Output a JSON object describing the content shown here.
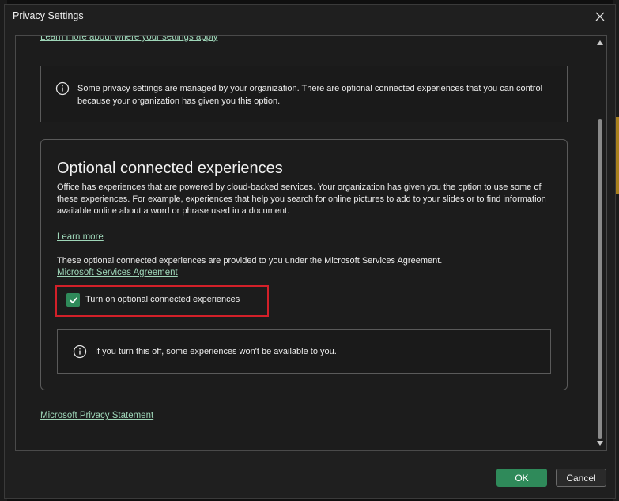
{
  "window": {
    "title": "Privacy Settings"
  },
  "content": {
    "top_link": "Learn more about where your settings apply",
    "notice": {
      "icon": "info-icon",
      "text": "Some privacy settings are managed by your organization. There are optional connected experiences that you can control because your organization has given you this option."
    },
    "section": {
      "title": "Optional connected experiences",
      "description": "Office has experiences that are powered by cloud-backed services. Your organization has given you the option to use some of these experiences. For example, experiences that help you search for online pictures to add to your slides or to find information available online about a word or phrase used in a document.",
      "learn_more": "Learn more",
      "agreement_text": "These optional connected experiences are provided to you under the Microsoft Services Agreement.",
      "agreement_link": "Microsoft Services Agreement",
      "checkbox": {
        "label": "Turn on optional connected experiences",
        "checked": true
      },
      "warning": {
        "icon": "info-icon",
        "text": "If you turn this off, some experiences won't be available to you."
      }
    },
    "privacy_link": "Microsoft Privacy Statement"
  },
  "buttons": {
    "ok": "OK",
    "cancel": "Cancel"
  },
  "colors": {
    "accent": "#2f8a5a",
    "link": "#9ed6b8",
    "highlight": "#d32029",
    "background": "#1f1f1f"
  }
}
